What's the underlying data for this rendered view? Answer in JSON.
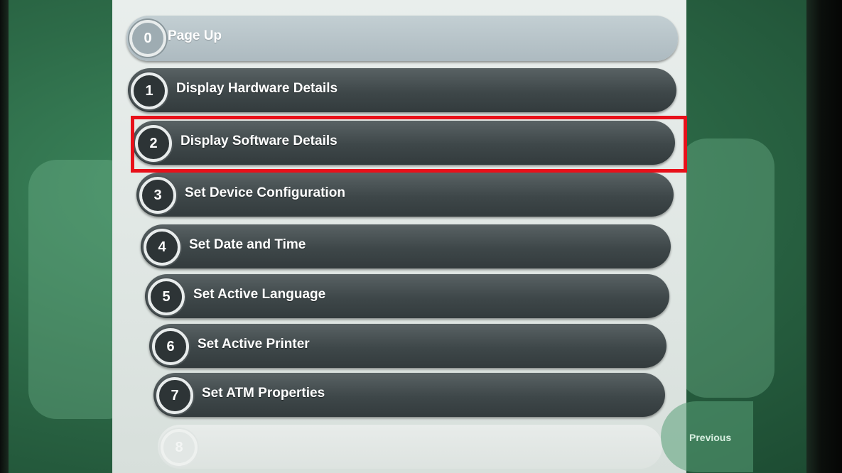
{
  "menu": {
    "items": [
      {
        "number": "0",
        "label": "Page Up"
      },
      {
        "number": "1",
        "label": "Display Hardware Details"
      },
      {
        "number": "2",
        "label": "Display Software Details"
      },
      {
        "number": "3",
        "label": "Set Device Configuration"
      },
      {
        "number": "4",
        "label": "Set Date and Time"
      },
      {
        "number": "5",
        "label": "Set Active Language"
      },
      {
        "number": "6",
        "label": "Set Active Printer"
      },
      {
        "number": "7",
        "label": "Set ATM Properties"
      },
      {
        "number": "8",
        "label": ""
      }
    ]
  },
  "nav": {
    "previous_label": "Previous"
  },
  "colors": {
    "highlight": "#e8101a",
    "background": "#2d6b48",
    "button": "#3e4749"
  }
}
